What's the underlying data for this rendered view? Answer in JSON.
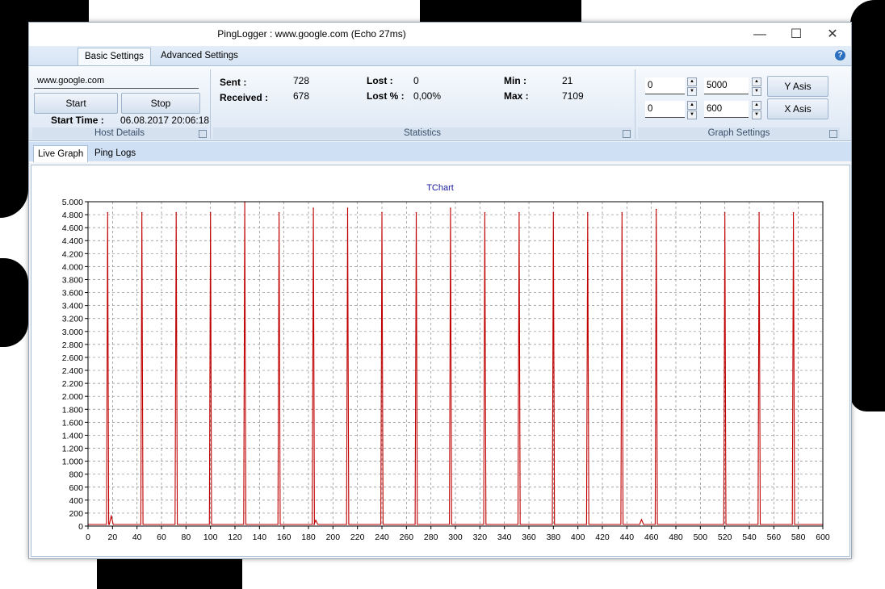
{
  "window": {
    "title": "PingLogger : www.google.com (Echo 27ms)",
    "minimize": "—",
    "maximize": "☐",
    "close": "✕"
  },
  "ribbon_tabs": [
    {
      "label": "Basic Settings",
      "active": true
    },
    {
      "label": "Advanced Settings",
      "active": false
    }
  ],
  "host_details": {
    "host": "www.google.com",
    "start_button": "Start",
    "stop_button": "Stop",
    "start_time_label": "Start Time :",
    "start_time_value": "06.08.2017 20:06:18",
    "group_label": "Host Details"
  },
  "statistics": {
    "sent_label": "Sent :",
    "sent_value": "728",
    "received_label": "Received :",
    "received_value": "678",
    "lost_label": "Lost :",
    "lost_value": "0",
    "lost_pct_label": "Lost  % :",
    "lost_pct_value": "0,00%",
    "min_label": "Min :",
    "min_value": "21",
    "max_label": "Max :",
    "max_value": "7109",
    "group_label": "Statistics"
  },
  "graph_settings": {
    "y_min": "0",
    "y_max": "5000",
    "x_min": "0",
    "x_max": "600",
    "y_axis_button": "Y Asis",
    "x_axis_button": "X Asis",
    "group_label": "Graph Settings"
  },
  "content_tabs": [
    {
      "label": "Live Graph",
      "active": true
    },
    {
      "label": "Ping Logs",
      "active": false
    }
  ],
  "chart_data": {
    "type": "line",
    "title": "TChart",
    "xlim": [
      0,
      600
    ],
    "ylim": [
      0,
      5000
    ],
    "x_ticks": [
      0,
      20,
      40,
      60,
      80,
      100,
      120,
      140,
      160,
      180,
      200,
      220,
      240,
      260,
      280,
      300,
      320,
      340,
      360,
      380,
      400,
      420,
      440,
      460,
      480,
      500,
      520,
      540,
      560,
      580,
      600
    ],
    "y_tick_labels": [
      "0",
      "200",
      "400",
      "600",
      "800",
      "1.000",
      "1.200",
      "1.400",
      "1.600",
      "1.800",
      "2.000",
      "2.200",
      "2.400",
      "2.600",
      "2.800",
      "3.000",
      "3.200",
      "3.400",
      "3.600",
      "3.800",
      "4.000",
      "4.200",
      "4.400",
      "4.600",
      "4.800",
      "5.000"
    ],
    "y_ticks": [
      0,
      200,
      400,
      600,
      800,
      1000,
      1200,
      1400,
      1600,
      1800,
      2000,
      2200,
      2400,
      2600,
      2800,
      3000,
      3200,
      3400,
      3600,
      3800,
      4000,
      4200,
      4400,
      4600,
      4800,
      5000
    ],
    "grid": true,
    "line_color": "#c00000",
    "baseline": 25,
    "spikes": [
      {
        "x": 16,
        "y": 4830
      },
      {
        "x": 44,
        "y": 4830
      },
      {
        "x": 72,
        "y": 4830
      },
      {
        "x": 100,
        "y": 4830
      },
      {
        "x": 128,
        "y": 5000
      },
      {
        "x": 156,
        "y": 4830
      },
      {
        "x": 184,
        "y": 4900
      },
      {
        "x": 212,
        "y": 4900
      },
      {
        "x": 240,
        "y": 4830
      },
      {
        "x": 268,
        "y": 4830
      },
      {
        "x": 296,
        "y": 4900
      },
      {
        "x": 324,
        "y": 4830
      },
      {
        "x": 352,
        "y": 4830
      },
      {
        "x": 380,
        "y": 4830
      },
      {
        "x": 408,
        "y": 4830
      },
      {
        "x": 436,
        "y": 4830
      },
      {
        "x": 464,
        "y": 4880
      },
      {
        "x": 520,
        "y": 4830
      },
      {
        "x": 548,
        "y": 4830
      },
      {
        "x": 576,
        "y": 4830
      }
    ],
    "small_bumps": [
      {
        "x": 19,
        "y": 160
      },
      {
        "x": 186,
        "y": 90
      },
      {
        "x": 452,
        "y": 100
      }
    ]
  }
}
